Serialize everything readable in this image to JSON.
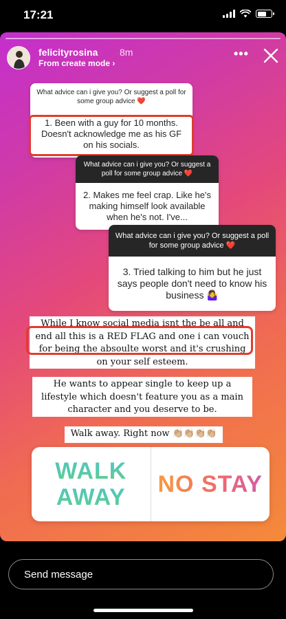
{
  "status_bar": {
    "time": "17:21"
  },
  "story": {
    "username": "felicityrosina",
    "time_ago": "8m",
    "mode_link": "From create mode ›",
    "more_icon": "more-dots-icon",
    "close_icon": "close-icon",
    "questions": [
      {
        "prompt": "What advice can i give you? Or suggest a poll for some group advice ❤️",
        "answer": "1. Been with a guy for 10 months. Doesn't acknowledge me as his GF on his socials."
      },
      {
        "prompt": "What advice can i give you? Or suggest a poll for some group advice ❤️",
        "answer": "2. Makes me feel crap. Like he's making himself look available when he's not. I've..."
      },
      {
        "prompt": "What advice can i give you? Or suggest a poll for some group advice ❤️",
        "answer": "3. Tried talking to him but he just says people don't need to know his business 🤷‍♀️"
      }
    ],
    "notes": [
      "While I know social media isnt the be all and end all this is a RED FLAG and one i can vouch for being the absoulte worst and it's crushing on your self esteem.",
      "He wants to appear single to keep up a lifestyle which doesn't feature you as a main character and you deserve to be.",
      "Walk away. Right now 👏🏼👏🏼👏🏼👏🏼"
    ],
    "poll": {
      "option_1": [
        "WALK",
        "AWAY"
      ],
      "option_2": "NO STAY"
    }
  },
  "message_input": {
    "placeholder": "Send message"
  },
  "colors": {
    "highlight_red": "#e13c2c",
    "poll_walk": "#4fc3c9",
    "poll_stay": "#f06c68"
  }
}
